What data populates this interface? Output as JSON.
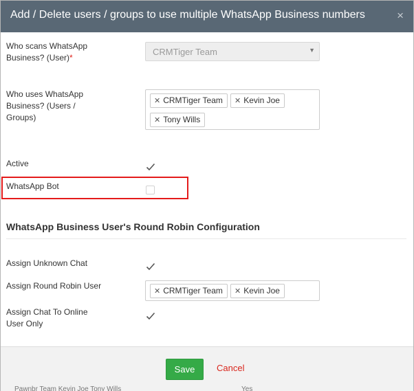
{
  "header": {
    "title": "Add / Delete users / groups to use multiple WhatsApp Business numbers",
    "close_glyph": "×"
  },
  "fields": {
    "scan_user": {
      "label_line1": "Who scans WhatsApp",
      "label_line2": "Business? (User)",
      "required_mark": "*",
      "value": "CRMTiger Team"
    },
    "uses": {
      "label_line1": "Who uses WhatsApp",
      "label_line2": "Business? (Users /",
      "label_line3": "Groups)",
      "tags": [
        "CRMTiger Team",
        "Kevin Joe",
        "Tony Wills"
      ]
    },
    "active": {
      "label": "Active",
      "checked": true
    },
    "whatsapp_bot": {
      "label": "WhatsApp Bot",
      "checked": false
    }
  },
  "round_robin": {
    "title": "WhatsApp Business User's Round Robin Configuration",
    "assign_unknown": {
      "label": "Assign Unknown Chat",
      "checked": true
    },
    "assign_rr_user": {
      "label": "Assign Round Robin User",
      "tags": [
        "CRMTiger Team",
        "Kevin Joe"
      ]
    },
    "assign_online": {
      "label_line1": "Assign Chat To Online",
      "label_line2": "User Only",
      "checked": true
    }
  },
  "footer": {
    "save_label": "Save",
    "cancel_label": "Cancel"
  },
  "background_leak": {
    "left_text": "Pawnbr Team Kevin Joe Tony Wills",
    "right_text": "Yes"
  },
  "colors": {
    "header_bg": "#596875",
    "save_bg": "#35aa47",
    "cancel_text": "#d9261c",
    "highlight_border": "#e41a1a",
    "required": "#e0221b"
  },
  "icons": {
    "check": "check-icon",
    "close": "close-icon",
    "tag_remove": "tag-remove-icon",
    "caret": "chevron-down-icon"
  }
}
